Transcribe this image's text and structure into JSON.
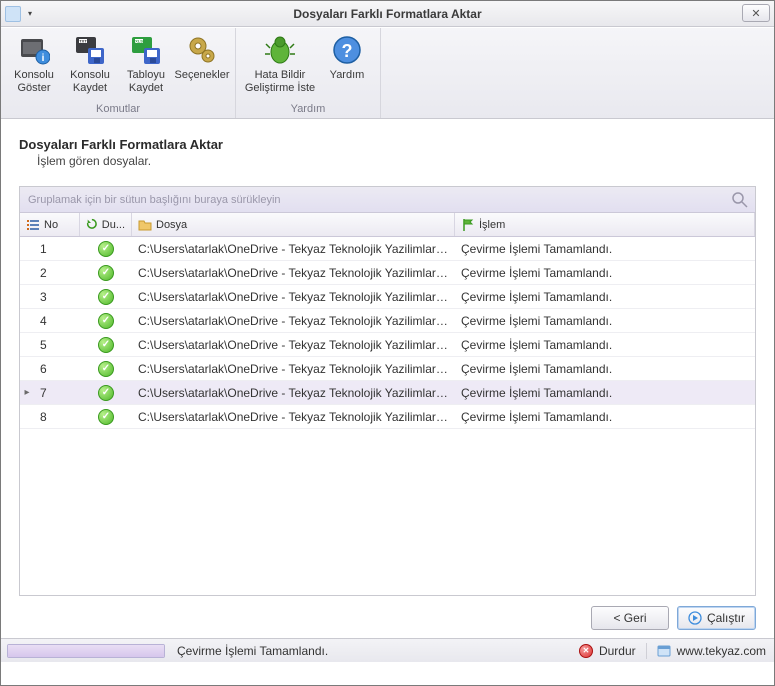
{
  "window": {
    "title": "Dosyaları Farklı Formatlara Aktar"
  },
  "ribbon": {
    "groups": [
      {
        "caption": "Komutlar",
        "items": [
          {
            "id": "show-console",
            "label": "Konsolu\nGöster"
          },
          {
            "id": "save-console",
            "label": "Konsolu\nKaydet"
          },
          {
            "id": "save-table",
            "label": "Tabloyu\nKaydet"
          },
          {
            "id": "options",
            "label": "Seçenekler"
          }
        ]
      },
      {
        "caption": "Yardım",
        "items": [
          {
            "id": "report-bug",
            "label": "Hata Bildir\nGeliştirme İste"
          },
          {
            "id": "help",
            "label": "Yardım"
          }
        ]
      }
    ]
  },
  "page": {
    "heading": "Dosyaları Farklı Formatlara Aktar",
    "subheading": "İşlem gören dosyalar."
  },
  "grid": {
    "group_hint": "Gruplamak için bir sütun başlığını buraya sürükleyin",
    "columns": {
      "no": "No",
      "status": "Du...",
      "file": "Dosya",
      "op": "İşlem"
    },
    "rows": [
      {
        "no": "1",
        "file": "C:\\Users\\atarlak\\OneDrive - Tekyaz Teknolojik Yazilimlar Ma...",
        "op": "Çevirme İşlemi Tamamlandı."
      },
      {
        "no": "2",
        "file": "C:\\Users\\atarlak\\OneDrive - Tekyaz Teknolojik Yazilimlar Ma...",
        "op": "Çevirme İşlemi Tamamlandı."
      },
      {
        "no": "3",
        "file": "C:\\Users\\atarlak\\OneDrive - Tekyaz Teknolojik Yazilimlar Ma...",
        "op": "Çevirme İşlemi Tamamlandı."
      },
      {
        "no": "4",
        "file": "C:\\Users\\atarlak\\OneDrive - Tekyaz Teknolojik Yazilimlar Ma...",
        "op": "Çevirme İşlemi Tamamlandı."
      },
      {
        "no": "5",
        "file": "C:\\Users\\atarlak\\OneDrive - Tekyaz Teknolojik Yazilimlar Ma...",
        "op": "Çevirme İşlemi Tamamlandı."
      },
      {
        "no": "6",
        "file": "C:\\Users\\atarlak\\OneDrive - Tekyaz Teknolojik Yazilimlar Ma...",
        "op": "Çevirme İşlemi Tamamlandı."
      },
      {
        "no": "7",
        "file": "C:\\Users\\atarlak\\OneDrive - Tekyaz Teknolojik Yazilimlar Ma...",
        "op": "Çevirme İşlemi Tamamlandı."
      },
      {
        "no": "8",
        "file": "C:\\Users\\atarlak\\OneDrive - Tekyaz Teknolojik Yazilimlar Ma...",
        "op": "Çevirme İşlemi Tamamlandı."
      }
    ],
    "selected_index": 6
  },
  "buttons": {
    "back": "< Geri",
    "run": "Çalıştır"
  },
  "status": {
    "message": "Çevirme İşlemi Tamamlandı.",
    "stop": "Durdur",
    "site": "www.tekyaz.com"
  }
}
